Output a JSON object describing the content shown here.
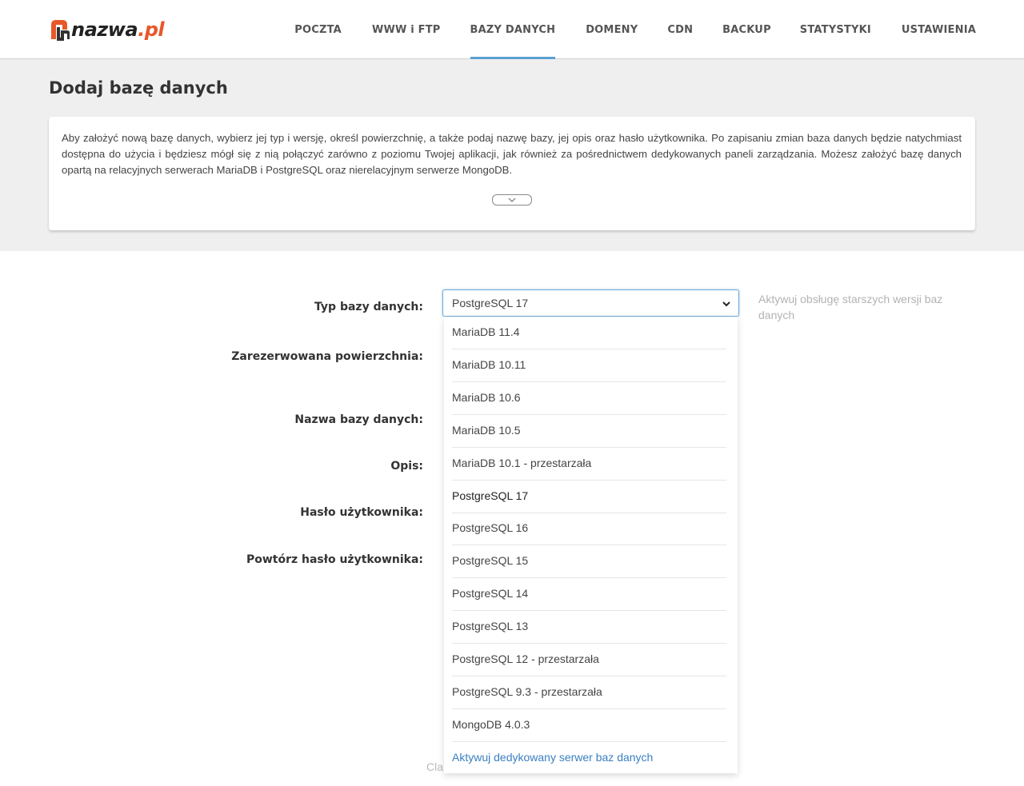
{
  "brand": {
    "name": "nazwa",
    "tld": ".pl"
  },
  "nav": [
    {
      "label": "POCZTA"
    },
    {
      "label": "WWW i FTP"
    },
    {
      "label": "BAZY DANYCH"
    },
    {
      "label": "DOMENY"
    },
    {
      "label": "CDN"
    },
    {
      "label": "BACKUP"
    },
    {
      "label": "STATYSTYKI"
    },
    {
      "label": "USTAWIENIA"
    }
  ],
  "active_nav": "BAZY DANYCH",
  "page": {
    "title": "Dodaj bazę danych",
    "info": "Aby założyć nową bazę danych, wybierz jej typ i wersję, określ powierzchnię, a także podaj nazwę bazy, jej opis oraz hasło użytkownika. Po zapisaniu zmian baza danych będzie natychmiast dostępna do użycia i będziesz mógł się z nią połączyć zarówno z poziomu Twojej aplikacji, jak również za pośrednictwem dedykowanych paneli zarządzania. Możesz założyć bazę danych opartą na relacyjnych serwerach MariaDB i PostgreSQL oraz nierelacyjnym serwerze MongoDB."
  },
  "form": {
    "labels": {
      "db_type": "Typ bazy danych:",
      "storage": "Zarezerwowana powierzchnia:",
      "db_name": "Nazwa bazy danych:",
      "description": "Opis:",
      "password": "Hasło użytkownika:",
      "password_repeat": "Powtórz hasło użytkownika:"
    },
    "db_type_value": "PostgreSQL 17",
    "hint": "Aktywuj obsługę starszych wersji baz danych",
    "partial_hidden": "Cla"
  },
  "dropdown": {
    "options": [
      "MariaDB 11.4",
      "MariaDB 10.11",
      "MariaDB 10.6",
      "MariaDB 10.5",
      "MariaDB 10.1 - przestarzała",
      "PostgreSQL 17",
      "PostgreSQL 16",
      "PostgreSQL 15",
      "PostgreSQL 14",
      "PostgreSQL 13",
      "PostgreSQL 12 - przestarzała",
      "PostgreSQL 9.3 - przestarzała",
      "MongoDB 4.0.3"
    ],
    "selected": "PostgreSQL 17",
    "footer_link": "Aktywuj dedykowany serwer baz danych"
  },
  "colors": {
    "accent": "#5aa0d0",
    "brand_orange": "#e8572a",
    "link": "#3a7fc1"
  }
}
